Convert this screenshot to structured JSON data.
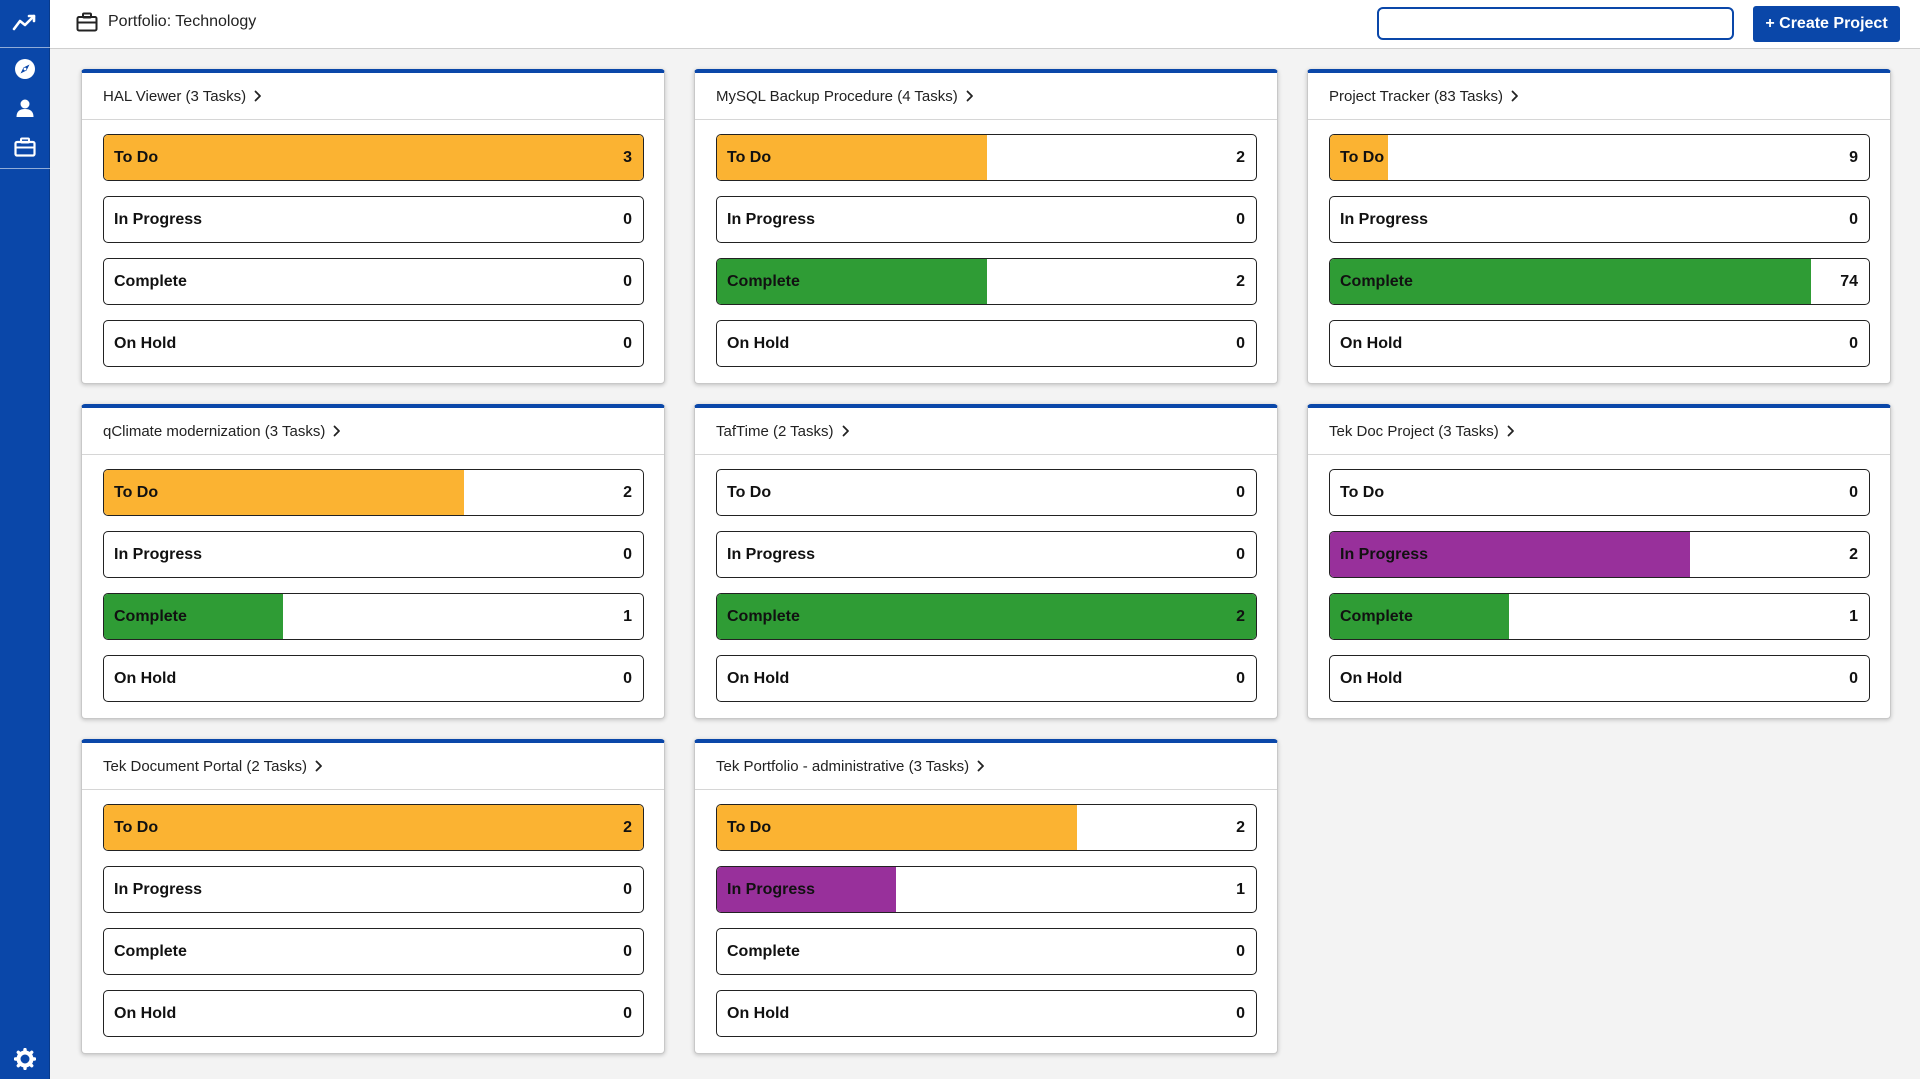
{
  "header": {
    "title": "Portfolio: Technology",
    "create_label": "+ Create Project",
    "search_value": "",
    "search_placeholder": ""
  },
  "sidebar": {
    "icons": [
      "activity-icon",
      "compass-icon",
      "user-icon",
      "briefcase-icon",
      "gear-icon"
    ]
  },
  "colors": {
    "primary": "#0a47a9",
    "To Do": "#fbb332",
    "In Progress": "#98309b",
    "Complete": "#2f9c35",
    "On Hold": "#9e9e9e"
  },
  "projects": [
    {
      "title": "HAL Viewer (3 Tasks)",
      "statuses": [
        {
          "label": "To Do",
          "count": 3,
          "fill": 1.0
        },
        {
          "label": "In Progress",
          "count": 0,
          "fill": 0
        },
        {
          "label": "Complete",
          "count": 0,
          "fill": 0
        },
        {
          "label": "On Hold",
          "count": 0,
          "fill": 0
        }
      ]
    },
    {
      "title": "MySQL Backup Procedure (4 Tasks)",
      "statuses": [
        {
          "label": "To Do",
          "count": 2,
          "fill": 0.5
        },
        {
          "label": "In Progress",
          "count": 0,
          "fill": 0
        },
        {
          "label": "Complete",
          "count": 2,
          "fill": 0.5
        },
        {
          "label": "On Hold",
          "count": 0,
          "fill": 0
        }
      ]
    },
    {
      "title": "Project Tracker (83 Tasks)",
      "statuses": [
        {
          "label": "To Do",
          "count": 9,
          "fill": 0.108
        },
        {
          "label": "In Progress",
          "count": 0,
          "fill": 0
        },
        {
          "label": "Complete",
          "count": 74,
          "fill": 0.892
        },
        {
          "label": "On Hold",
          "count": 0,
          "fill": 0
        }
      ]
    },
    {
      "title": "qClimate modernization (3 Tasks)",
      "statuses": [
        {
          "label": "To Do",
          "count": 2,
          "fill": 0.667
        },
        {
          "label": "In Progress",
          "count": 0,
          "fill": 0
        },
        {
          "label": "Complete",
          "count": 1,
          "fill": 0.333
        },
        {
          "label": "On Hold",
          "count": 0,
          "fill": 0
        }
      ]
    },
    {
      "title": "TafTime (2 Tasks)",
      "statuses": [
        {
          "label": "To Do",
          "count": 0,
          "fill": 0
        },
        {
          "label": "In Progress",
          "count": 0,
          "fill": 0
        },
        {
          "label": "Complete",
          "count": 2,
          "fill": 1.0
        },
        {
          "label": "On Hold",
          "count": 0,
          "fill": 0
        }
      ]
    },
    {
      "title": "Tek Doc Project (3 Tasks)",
      "statuses": [
        {
          "label": "To Do",
          "count": 0,
          "fill": 0
        },
        {
          "label": "In Progress",
          "count": 2,
          "fill": 0.667
        },
        {
          "label": "Complete",
          "count": 1,
          "fill": 0.333
        },
        {
          "label": "On Hold",
          "count": 0,
          "fill": 0
        }
      ]
    },
    {
      "title": "Tek Document Portal (2 Tasks)",
      "statuses": [
        {
          "label": "To Do",
          "count": 2,
          "fill": 1.0
        },
        {
          "label": "In Progress",
          "count": 0,
          "fill": 0
        },
        {
          "label": "Complete",
          "count": 0,
          "fill": 0
        },
        {
          "label": "On Hold",
          "count": 0,
          "fill": 0
        }
      ]
    },
    {
      "title": "Tek Portfolio - administrative (3 Tasks)",
      "statuses": [
        {
          "label": "To Do",
          "count": 2,
          "fill": 0.667
        },
        {
          "label": "In Progress",
          "count": 1,
          "fill": 0.333
        },
        {
          "label": "Complete",
          "count": 0,
          "fill": 0
        },
        {
          "label": "On Hold",
          "count": 0,
          "fill": 0
        }
      ]
    }
  ]
}
